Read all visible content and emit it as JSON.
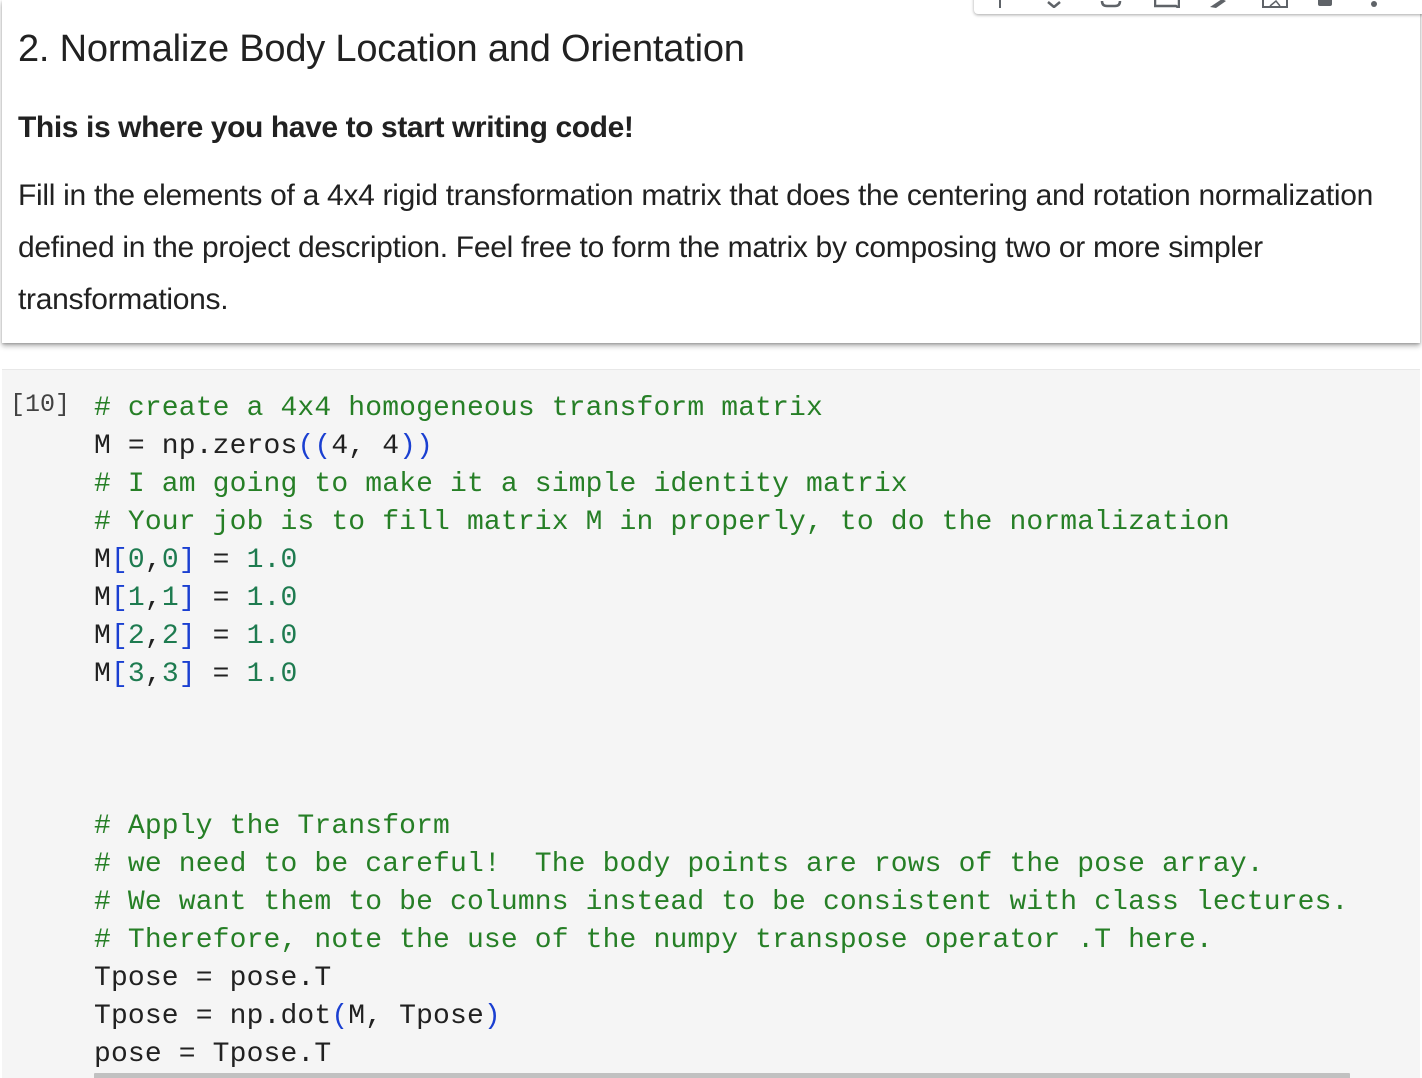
{
  "markdown_cell": {
    "title": "2. Normalize Body Location and Orientation",
    "bold_text": "This is where you have to start writing code!",
    "paragraph": "Fill in the elements of a 4x4 rigid transformation matrix that does the centering and rotation normalization defined in the project description. Feel free to form the matrix by composing two or more simpler transformations.",
    "toolbar_icons": [
      "move-up-icon",
      "move-down-icon",
      "link-icon",
      "comment-icon",
      "edit-icon",
      "mirror-cell-icon",
      "delete-icon",
      "more-icon"
    ]
  },
  "code_cell": {
    "execution_count": "[10]",
    "lines": [
      [
        {
          "t": "c",
          "v": "# create a 4x4 homogeneous transform matrix"
        }
      ],
      [
        {
          "t": "p",
          "v": "M = np.zeros"
        },
        {
          "t": "b",
          "v": "(("
        },
        {
          "t": "p",
          "v": "4, 4"
        },
        {
          "t": "b",
          "v": "))"
        }
      ],
      [
        {
          "t": "c",
          "v": "# I am going to make it a simple identity matrix"
        }
      ],
      [
        {
          "t": "c",
          "v": "# Your job is to fill matrix M in properly, to do the normalization"
        }
      ],
      [
        {
          "t": "p",
          "v": "M"
        },
        {
          "t": "b",
          "v": "["
        },
        {
          "t": "n",
          "v": "0"
        },
        {
          "t": "p",
          "v": ","
        },
        {
          "t": "n",
          "v": "0"
        },
        {
          "t": "b",
          "v": "]"
        },
        {
          "t": "p",
          "v": " = "
        },
        {
          "t": "n",
          "v": "1.0"
        }
      ],
      [
        {
          "t": "p",
          "v": "M"
        },
        {
          "t": "b",
          "v": "["
        },
        {
          "t": "n",
          "v": "1"
        },
        {
          "t": "p",
          "v": ","
        },
        {
          "t": "n",
          "v": "1"
        },
        {
          "t": "b",
          "v": "]"
        },
        {
          "t": "p",
          "v": " = "
        },
        {
          "t": "n",
          "v": "1.0"
        }
      ],
      [
        {
          "t": "p",
          "v": "M"
        },
        {
          "t": "b",
          "v": "["
        },
        {
          "t": "n",
          "v": "2"
        },
        {
          "t": "p",
          "v": ","
        },
        {
          "t": "n",
          "v": "2"
        },
        {
          "t": "b",
          "v": "]"
        },
        {
          "t": "p",
          "v": " = "
        },
        {
          "t": "n",
          "v": "1.0"
        }
      ],
      [
        {
          "t": "p",
          "v": "M"
        },
        {
          "t": "b",
          "v": "["
        },
        {
          "t": "n",
          "v": "3"
        },
        {
          "t": "p",
          "v": ","
        },
        {
          "t": "n",
          "v": "3"
        },
        {
          "t": "b",
          "v": "]"
        },
        {
          "t": "p",
          "v": " = "
        },
        {
          "t": "n",
          "v": "1.0"
        }
      ],
      [],
      [],
      [],
      [
        {
          "t": "c",
          "v": "# Apply the Transform"
        }
      ],
      [
        {
          "t": "c",
          "v": "# we need to be careful!  The body points are rows of the pose array."
        }
      ],
      [
        {
          "t": "c",
          "v": "# We want them to be columns instead to be consistent with class lectures."
        }
      ],
      [
        {
          "t": "c",
          "v": "# Therefore, note the use of the numpy transpose operator .T here."
        }
      ],
      [
        {
          "t": "p",
          "v": "Tpose = pose.T"
        }
      ],
      [
        {
          "t": "p",
          "v": "Tpose = np.dot"
        },
        {
          "t": "b",
          "v": "("
        },
        {
          "t": "p",
          "v": "M, Tpose"
        },
        {
          "t": "b",
          "v": ")"
        }
      ],
      [
        {
          "t": "p",
          "v": "pose = Tpose.T"
        }
      ]
    ]
  },
  "colors": {
    "comment": "#267f26",
    "bracket": "#1a3fd1",
    "number": "#1e7b50",
    "code_background": "#f5f5f5"
  }
}
